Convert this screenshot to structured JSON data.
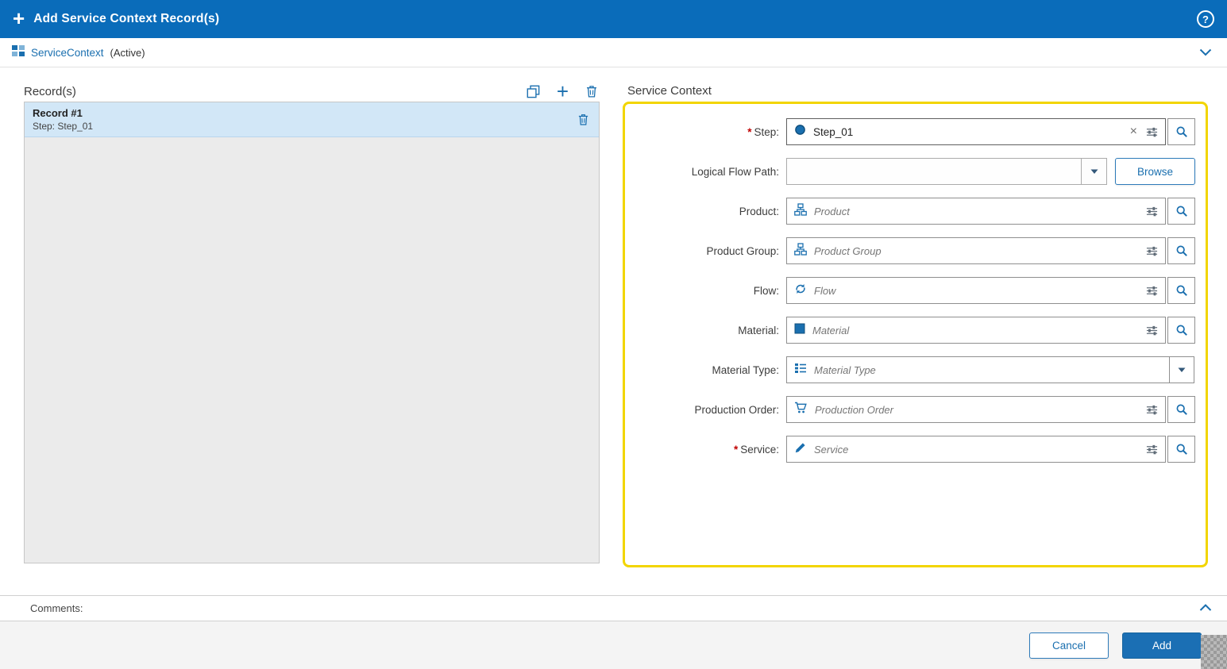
{
  "icons": {
    "plus": "+",
    "help": "?",
    "close": "×"
  },
  "header": {
    "title": "Add Service Context Record(s)"
  },
  "subheader": {
    "entity": "ServiceContext",
    "status": "(Active)"
  },
  "records": {
    "title": "Record(s)",
    "items": [
      {
        "title": "Record #1",
        "subtitle": "Step: Step_01"
      }
    ]
  },
  "form": {
    "title": "Service Context",
    "rows": {
      "step": {
        "label": "Step:",
        "required": "*",
        "value": "Step_01"
      },
      "logical_flow_path": {
        "label": "Logical Flow Path:",
        "value": "",
        "browse": "Browse"
      },
      "product": {
        "label": "Product:",
        "placeholder": "Product"
      },
      "product_group": {
        "label": "Product Group:",
        "placeholder": "Product Group"
      },
      "flow": {
        "label": "Flow:",
        "placeholder": "Flow"
      },
      "material": {
        "label": "Material:",
        "placeholder": "Material"
      },
      "material_type": {
        "label": "Material Type:",
        "placeholder": "Material Type"
      },
      "production_order": {
        "label": "Production Order:",
        "placeholder": "Production Order"
      },
      "service": {
        "label": "Service:",
        "required": "*",
        "placeholder": "Service"
      }
    }
  },
  "comments": {
    "label": "Comments:"
  },
  "footer": {
    "cancel": "Cancel",
    "add": "Add"
  },
  "colors": {
    "header_bg": "#0a6cba",
    "accent": "#1a6faf",
    "highlight_border": "#f2d500",
    "selected_record_bg": "#d2e7f7",
    "required": "#c00000"
  }
}
